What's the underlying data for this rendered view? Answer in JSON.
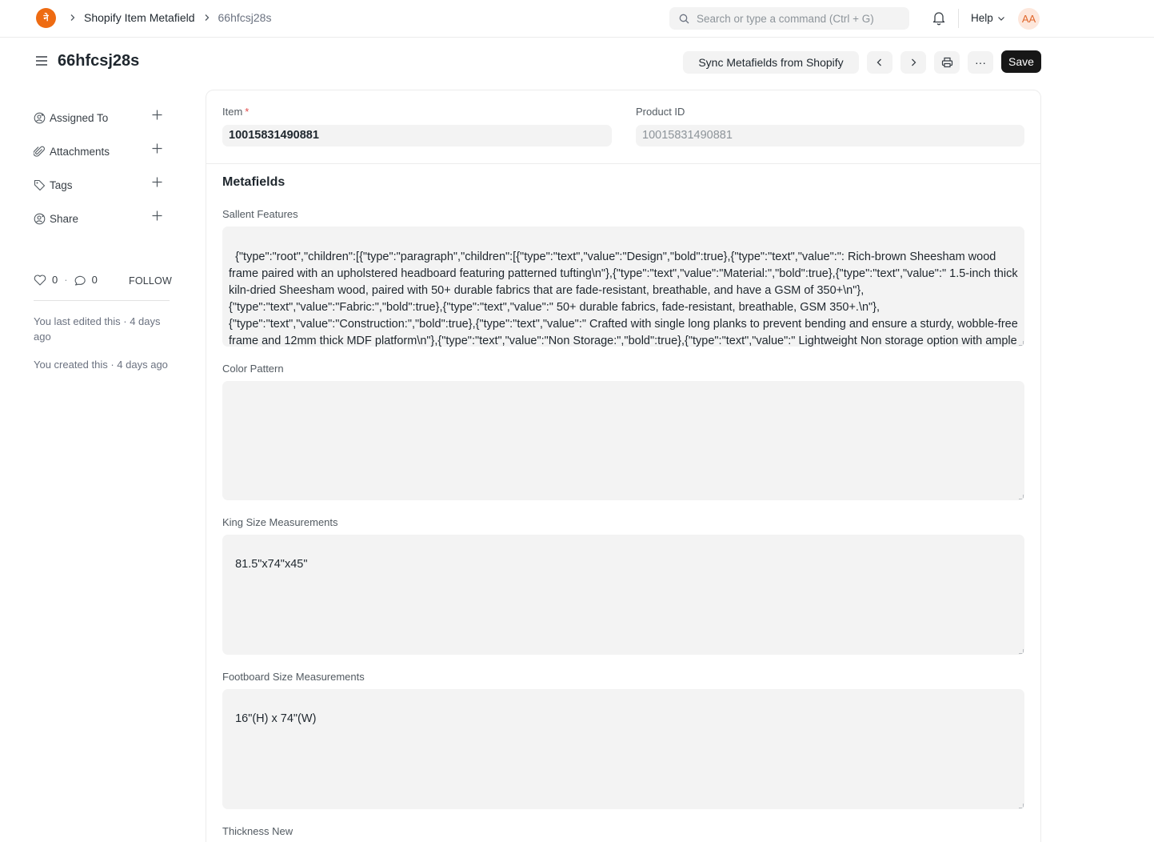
{
  "navbar": {
    "logo_letter": "ने",
    "breadcrumbs": [
      "Shopify Item Metafield",
      "66hfcsj28s"
    ],
    "search_placeholder": "Search or type a command (Ctrl + G)",
    "help_label": "Help",
    "avatar_initials": "AA"
  },
  "page": {
    "title": "66hfcsj28s",
    "sync_label": "Sync Metafields from Shopify",
    "save_label": "Save",
    "more_label": "···"
  },
  "sidebar": {
    "items": [
      {
        "label": "Assigned To",
        "icon": "user-add-icon"
      },
      {
        "label": "Attachments",
        "icon": "paperclip-icon"
      },
      {
        "label": "Tags",
        "icon": "tag-icon"
      },
      {
        "label": "Share",
        "icon": "share-user-icon"
      }
    ],
    "likes_count": "0",
    "comments_count": "0",
    "follow_label": "FOLLOW",
    "last_edited": "You last edited this · 4 days ago",
    "created": "You created this · 4 days ago"
  },
  "form": {
    "item_label": "Item",
    "item_required_mark": "*",
    "item_value": "10015831490881",
    "product_id_label": "Product ID",
    "product_id_value": "10015831490881",
    "section_title": "Metafields",
    "fields": [
      {
        "label": "Sallent Features",
        "value": "{\"type\":\"root\",\"children\":[{\"type\":\"paragraph\",\"children\":[{\"type\":\"text\",\"value\":\"Design\",\"bold\":true},{\"type\":\"text\",\"value\":\": Rich-brown Sheesham wood frame paired with an upholstered headboard featuring patterned tufting\\n\"},{\"type\":\"text\",\"value\":\"Material:\",\"bold\":true},{\"type\":\"text\",\"value\":\" 1.5-inch thick kiln-dried Sheesham wood, paired with 50+ durable fabrics that are fade-resistant, breathable, and have a GSM of 350+\\n\"},{\"type\":\"text\",\"value\":\"Fabric:\",\"bold\":true},{\"type\":\"text\",\"value\":\" 50+ durable fabrics, fade-resistant, breathable, GSM 350+.\\n\"},{\"type\":\"text\",\"value\":\"Construction:\",\"bold\":true},{\"type\":\"text\",\"value\":\" Crafted with single long planks to prevent bending and ensure a sturdy, wobble-free frame and 12mm thick MDF platform\\n\"},{\"type\":\"text\",\"value\":\"Non Storage:\",\"bold\":true},{\"type\":\"text\",\"value\":\" Lightweight Non storage option with ample floor clearance for easy cleaning\"}]}]}"
      },
      {
        "label": "Color Pattern",
        "value": ""
      },
      {
        "label": "King Size Measurements",
        "value": "81.5\"x74\"x45\""
      },
      {
        "label": "Footboard Size Measurements",
        "value": "16\"(H) x 74\"(W)"
      },
      {
        "label": "Thickness New",
        "value": ""
      }
    ]
  }
}
